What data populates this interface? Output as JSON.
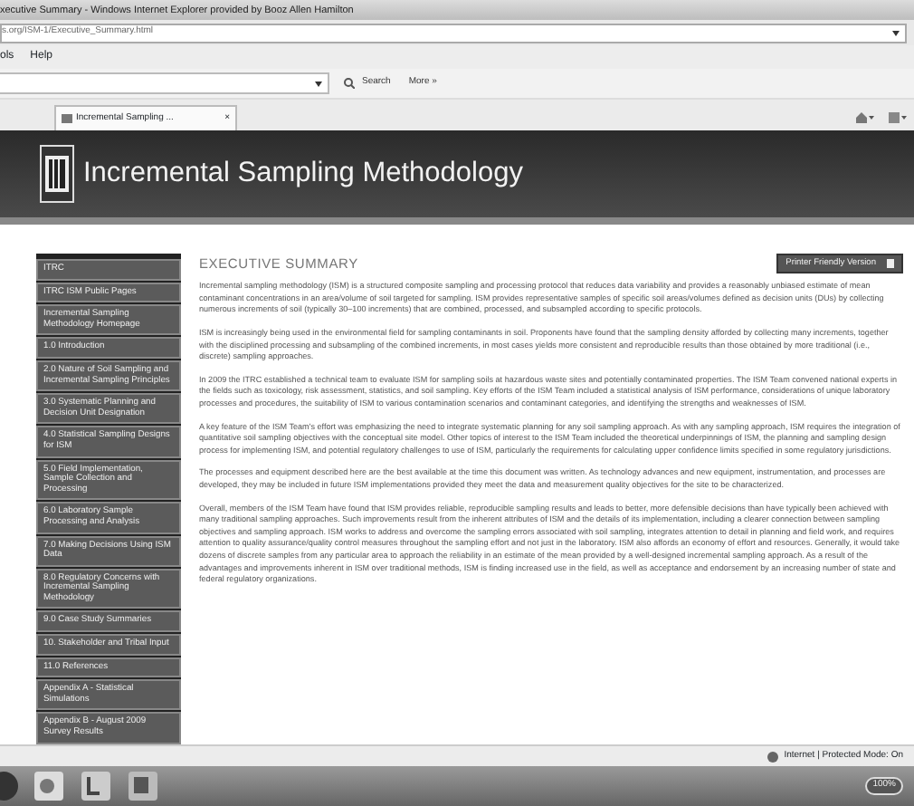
{
  "window": {
    "title": "xecutive Summary - Windows Internet Explorer provided by Booz Allen Hamilton"
  },
  "address_bar": {
    "url": "s.org/ISM-1/Executive_Summary.html"
  },
  "menu": [
    "ols",
    "Help"
  ],
  "toolbar": {
    "search": "Search",
    "more": "More »"
  },
  "tabs": [
    {
      "label": "Incremental Sampling ...",
      "close": "×",
      "selected": true
    }
  ],
  "banner": {
    "title": "Incremental Sampling Methodology"
  },
  "sidebar": {
    "items": [
      {
        "label": "ITRC"
      },
      {
        "label": "ITRC ISM Public Pages"
      },
      {
        "label": "Incremental Sampling Methodology Homepage"
      },
      {
        "label": "1.0 Introduction"
      },
      {
        "label": "2.0 Nature of Soil Sampling and Incremental Sampling Principles"
      },
      {
        "label": "3.0 Systematic Planning and Decision Unit Designation"
      },
      {
        "label": "4.0 Statistical Sampling Designs for ISM"
      },
      {
        "label": "5.0 Field Implementation, Sample Collection and Processing"
      },
      {
        "label": "6.0 Laboratory Sample Processing and Analysis"
      },
      {
        "label": "7.0 Making Decisions Using ISM Data"
      },
      {
        "label": "8.0 Regulatory Concerns with Incremental Sampling Methodology"
      },
      {
        "label": "9.0 Case Study Summaries"
      },
      {
        "label": "10. Stakeholder and Tribal Input"
      },
      {
        "label": "11.0 References"
      },
      {
        "label": "Appendix A - Statistical Simulations"
      },
      {
        "label": "Appendix B - August 2009 Survey Results"
      }
    ]
  },
  "content": {
    "heading": "EXECUTIVE SUMMARY",
    "printer_button": "Printer Friendly Version",
    "paragraphs": [
      "Incremental sampling methodology (ISM) is a structured composite sampling and processing protocol that reduces data variability and provides a reasonably unbiased estimate of mean contaminant concentrations in an area/volume of soil targeted for sampling. ISM provides representative samples of specific soil areas/volumes defined as decision units (DUs) by collecting numerous increments of soil (typically 30–100 increments) that are combined, processed, and subsampled according to specific protocols.",
      "ISM is increasingly being used in the environmental field for sampling contaminants in soil. Proponents have found that the sampling density afforded by collecting many increments, together with the disciplined processing and subsampling of the combined increments, in most cases yields more consistent and reproducible results than those obtained by more traditional (i.e., discrete) sampling approaches.",
      "In 2009 the ITRC established a technical team to evaluate ISM for sampling soils at hazardous waste sites and potentially contaminated properties. The ISM Team convened national experts in the fields such as toxicology, risk assessment, statistics, and soil sampling. Key efforts of the ISM Team included a statistical analysis of ISM performance, considerations of unique laboratory processes and procedures, the suitability of ISM to various contamination scenarios and contaminant categories, and identifying the strengths and weaknesses of ISM.",
      "A key feature of the ISM Team's effort was emphasizing the need to integrate systematic planning for any soil sampling approach. As with any sampling approach, ISM requires the integration of quantitative soil sampling objectives with the conceptual site model. Other topics of interest to the ISM Team included the theoretical underpinnings of ISM, the planning and sampling design process for implementing ISM, and potential regulatory challenges to use of ISM, particularly the requirements for calculating upper confidence limits specified in some regulatory jurisdictions.",
      "The processes and equipment described here are the best available at the time this document was written. As technology advances and new equipment, instrumentation, and processes are developed, they may be included in future ISM implementations provided they meet the data and measurement quality objectives for the site to be characterized.",
      "Overall, members of the ISM Team have found that ISM provides reliable, reproducible sampling results and leads to better, more defensible decisions than have typically been achieved with many traditional sampling approaches. Such improvements result from the inherent attributes of ISM and the details of its implementation, including a clearer connection between sampling objectives and sampling approach. ISM works to address and overcome the sampling errors associated with soil sampling, integrates attention to detail in planning and field work, and requires attention to quality assurance/quality control measures throughout the sampling effort and not just in the laboratory. ISM also affords an economy of effort and resources. Generally, it would take dozens of discrete samples from any particular area to approach the reliability in an estimate of the mean provided by a well-designed incremental sampling approach. As a result of the advantages and improvements inherent in ISM over traditional methods, ISM is finding increased use in the field, as well as acceptance and endorsement by an increasing number of state and federal regulatory organizations."
    ]
  },
  "status_bar": {
    "zone": "Internet | Protected Mode: On",
    "zoom": "100%"
  },
  "taskbar": {
    "apps": [
      {
        "kind": "orb"
      },
      {
        "kind": "mail"
      },
      {
        "kind": "chat"
      },
      {
        "kind": "editor"
      }
    ]
  }
}
